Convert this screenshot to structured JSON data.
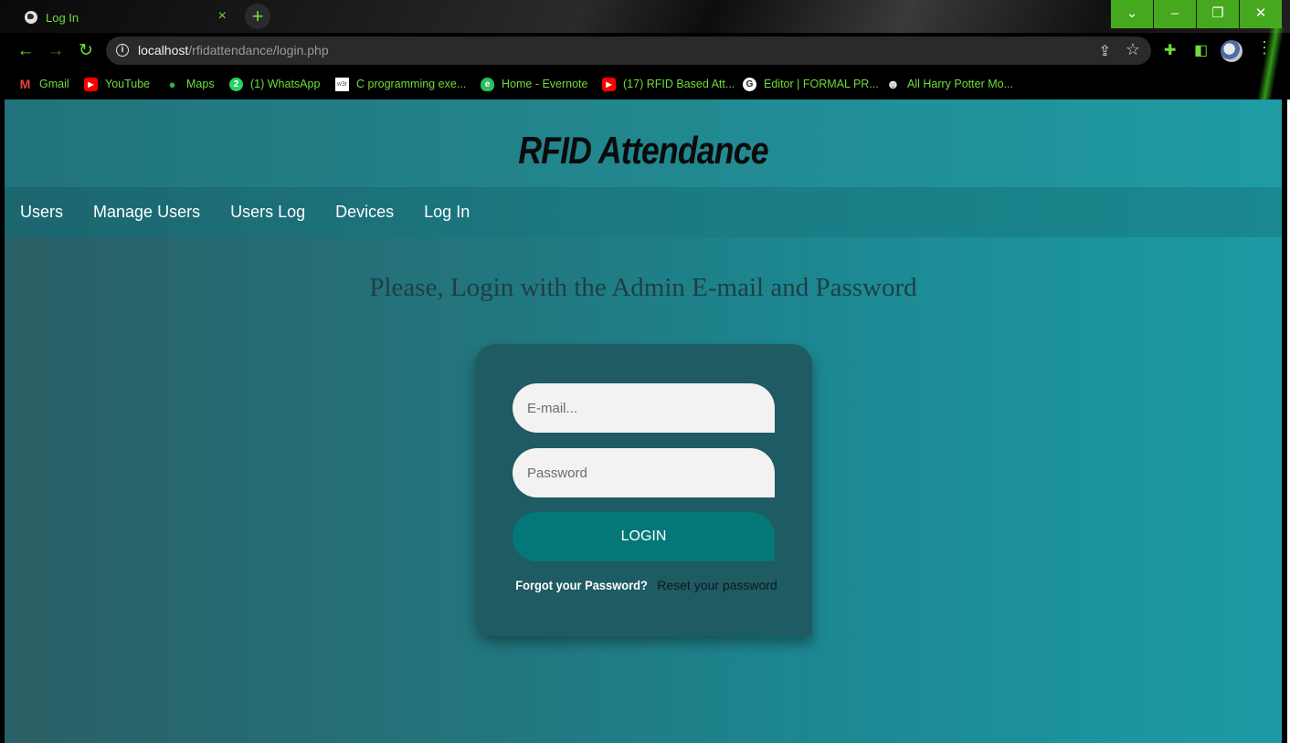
{
  "browser": {
    "tab_title": "Log In",
    "tab_close": "×",
    "new_tab": "+",
    "window_controls": [
      "⌄",
      "–",
      "❐",
      "✕"
    ],
    "url_host": "localhost",
    "url_path": "/rfidattendance/login.php",
    "bookmarks": [
      {
        "label": "Gmail",
        "icon": "M",
        "color": "#ea4335"
      },
      {
        "label": "YouTube",
        "icon": "▶",
        "color": "#ff0000"
      },
      {
        "label": "Maps",
        "icon": "●",
        "color": "#34a853"
      },
      {
        "label": "(1) WhatsApp",
        "icon": "2",
        "color": "#25d366"
      },
      {
        "label": "C programming exe...",
        "icon": "w3r",
        "color": "#ffffff"
      },
      {
        "label": "Home - Evernote",
        "icon": "e",
        "color": "#2dbe60"
      },
      {
        "label": "(17) RFID Based Att...",
        "icon": "▶",
        "color": "#ff0000"
      },
      {
        "label": "Editor | FORMAL PR...",
        "icon": "G",
        "color": "#ffffff"
      },
      {
        "label": "All Harry Potter Mo...",
        "icon": "☻",
        "color": "#e8e8e8"
      }
    ]
  },
  "site": {
    "title": "RFID Attendance",
    "nav": [
      "Users",
      "Manage Users",
      "Users Log",
      "Devices",
      "Log In"
    ],
    "prompt": "Please, Login with the Admin E-mail and Password"
  },
  "login": {
    "email_placeholder": "E-mail...",
    "password_placeholder": "Password",
    "button": "LOGIN",
    "forgot_question": "Forgot your Password?",
    "reset_link": "Reset your password"
  }
}
